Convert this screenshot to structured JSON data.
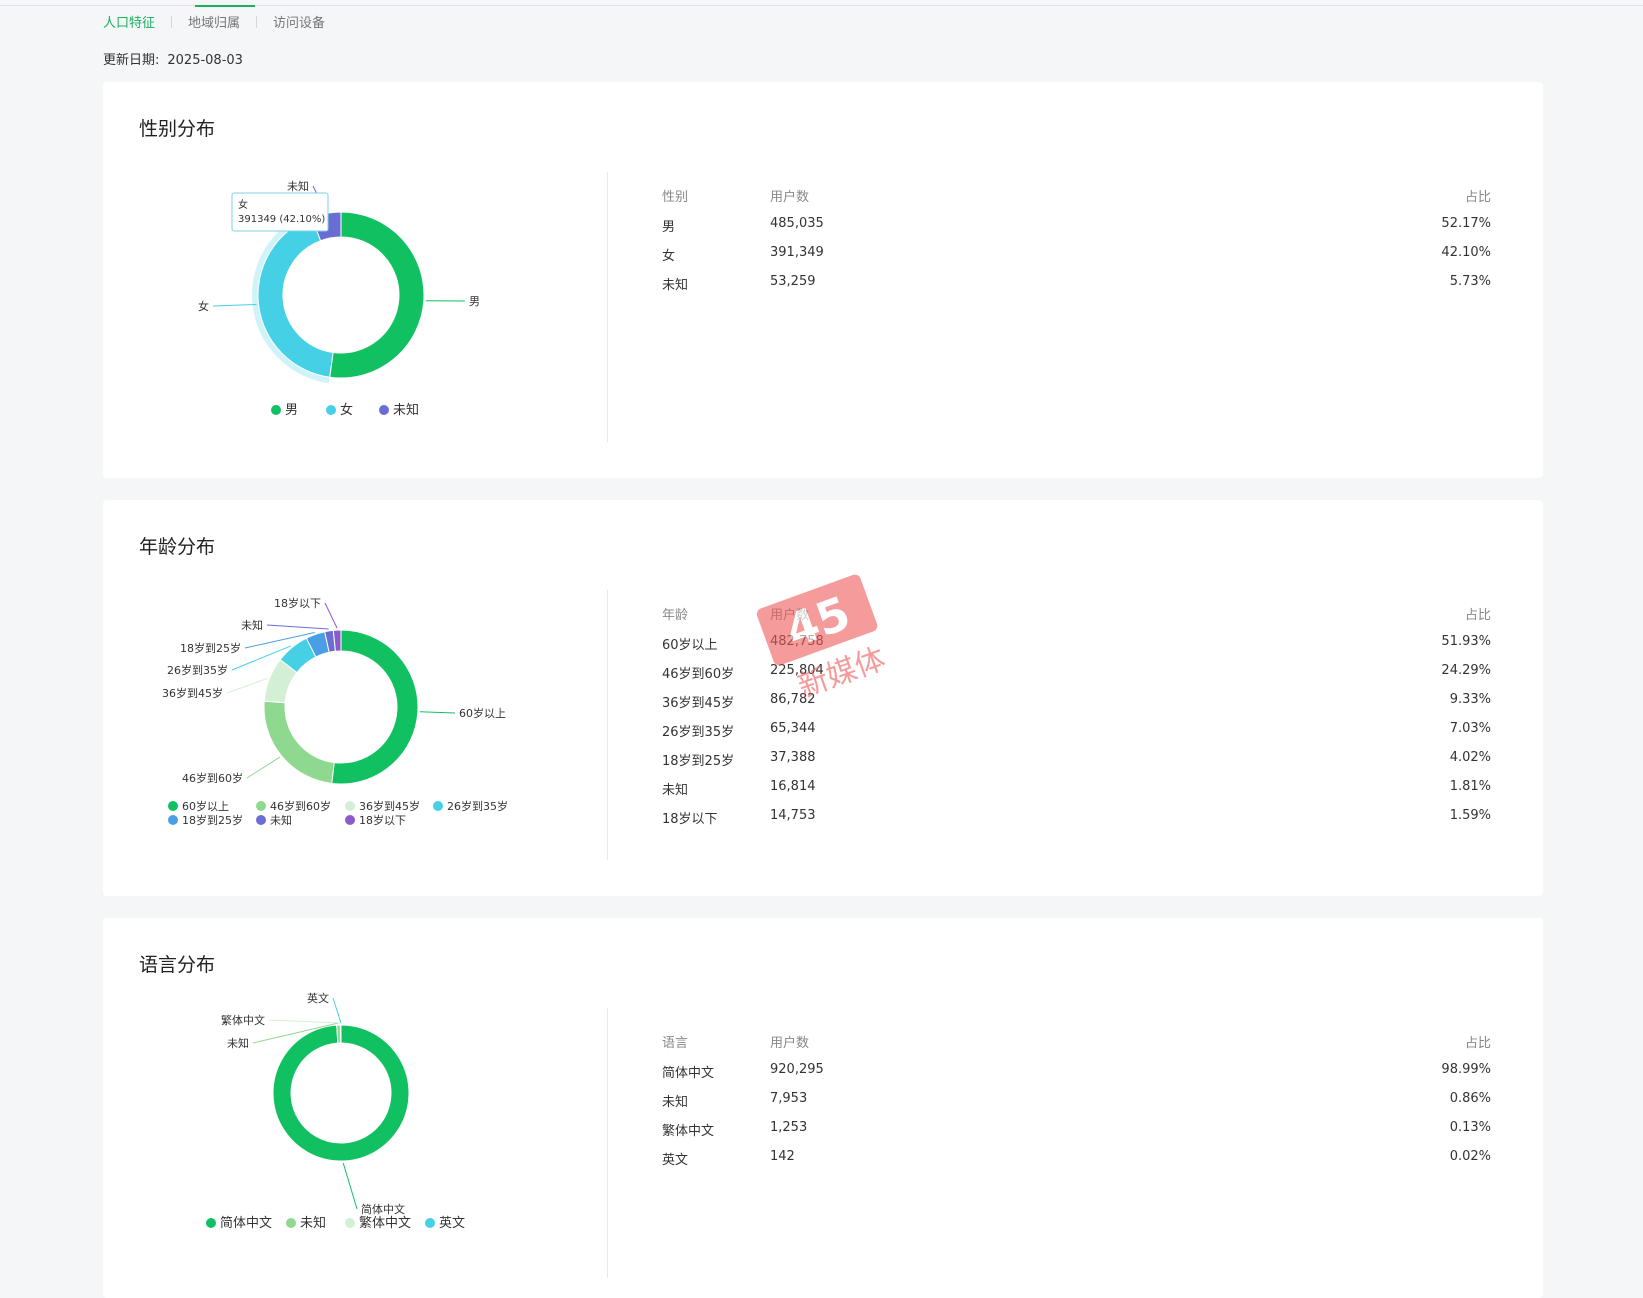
{
  "tabs": [
    "人口特征",
    "地域归属",
    "访问设备"
  ],
  "update": {
    "label": "更新日期:",
    "date": "2025-08-03"
  },
  "colors": {
    "accent": "#19b160",
    "male": "#11c060",
    "female": "#45d0e6",
    "unknown": "#6a6ed3"
  },
  "gender": {
    "title": "性别分布",
    "headers": [
      "性别",
      "用户数",
      "占比"
    ],
    "rows": [
      {
        "label": "男",
        "users": "485,035",
        "pct": "52.17%"
      },
      {
        "label": "女",
        "users": "391,349",
        "pct": "42.10%"
      },
      {
        "label": "未知",
        "users": "53,259",
        "pct": "5.73%"
      }
    ],
    "tooltip": {
      "name": "女",
      "value": "391349 (42.10%)"
    }
  },
  "age": {
    "title": "年龄分布",
    "headers": [
      "年龄",
      "用户数",
      "占比"
    ],
    "rows": [
      {
        "label": "60岁以上",
        "users": "482,758",
        "pct": "51.93%"
      },
      {
        "label": "46岁到60岁",
        "users": "225,804",
        "pct": "24.29%"
      },
      {
        "label": "36岁到45岁",
        "users": "86,782",
        "pct": "9.33%"
      },
      {
        "label": "26岁到35岁",
        "users": "65,344",
        "pct": "7.03%"
      },
      {
        "label": "18岁到25岁",
        "users": "37,388",
        "pct": "4.02%"
      },
      {
        "label": "未知",
        "users": "16,814",
        "pct": "1.81%"
      },
      {
        "label": "18岁以下",
        "users": "14,753",
        "pct": "1.59%"
      }
    ]
  },
  "language": {
    "title": "语言分布",
    "headers": [
      "语言",
      "用户数",
      "占比"
    ],
    "rows": [
      {
        "label": "简体中文",
        "users": "920,295",
        "pct": "98.99%"
      },
      {
        "label": "未知",
        "users": "7,953",
        "pct": "0.86%"
      },
      {
        "label": "繁体中文",
        "users": "1,253",
        "pct": "0.13%"
      },
      {
        "label": "英文",
        "users": "142",
        "pct": "0.02%"
      }
    ]
  },
  "watermark": "45新媒体",
  "chart_data": [
    {
      "type": "pie",
      "categories": [
        "男",
        "女",
        "未知"
      ],
      "values": [
        485035,
        391349,
        53259
      ],
      "colors": [
        "#11c060",
        "#45d0e6",
        "#6a6ed3"
      ],
      "legend": "bottom"
    },
    {
      "type": "pie",
      "categories": [
        "60岁以上",
        "46岁到60岁",
        "36岁到45岁",
        "26岁到35岁",
        "18岁到25岁",
        "未知",
        "18岁以下"
      ],
      "values": [
        482758,
        225804,
        86782,
        65344,
        37388,
        16814,
        14753
      ],
      "colors": [
        "#11c060",
        "#8fd88f",
        "#d3f0d6",
        "#45d0e6",
        "#4a9ee6",
        "#6a6ed3",
        "#8e5acb"
      ],
      "legend": "bottom"
    },
    {
      "type": "pie",
      "categories": [
        "简体中文",
        "未知",
        "繁体中文",
        "英文"
      ],
      "values": [
        920295,
        7953,
        1253,
        142
      ],
      "colors": [
        "#11c060",
        "#8fd88f",
        "#d3f0d6",
        "#45d0e6"
      ],
      "legend": "bottom"
    }
  ]
}
